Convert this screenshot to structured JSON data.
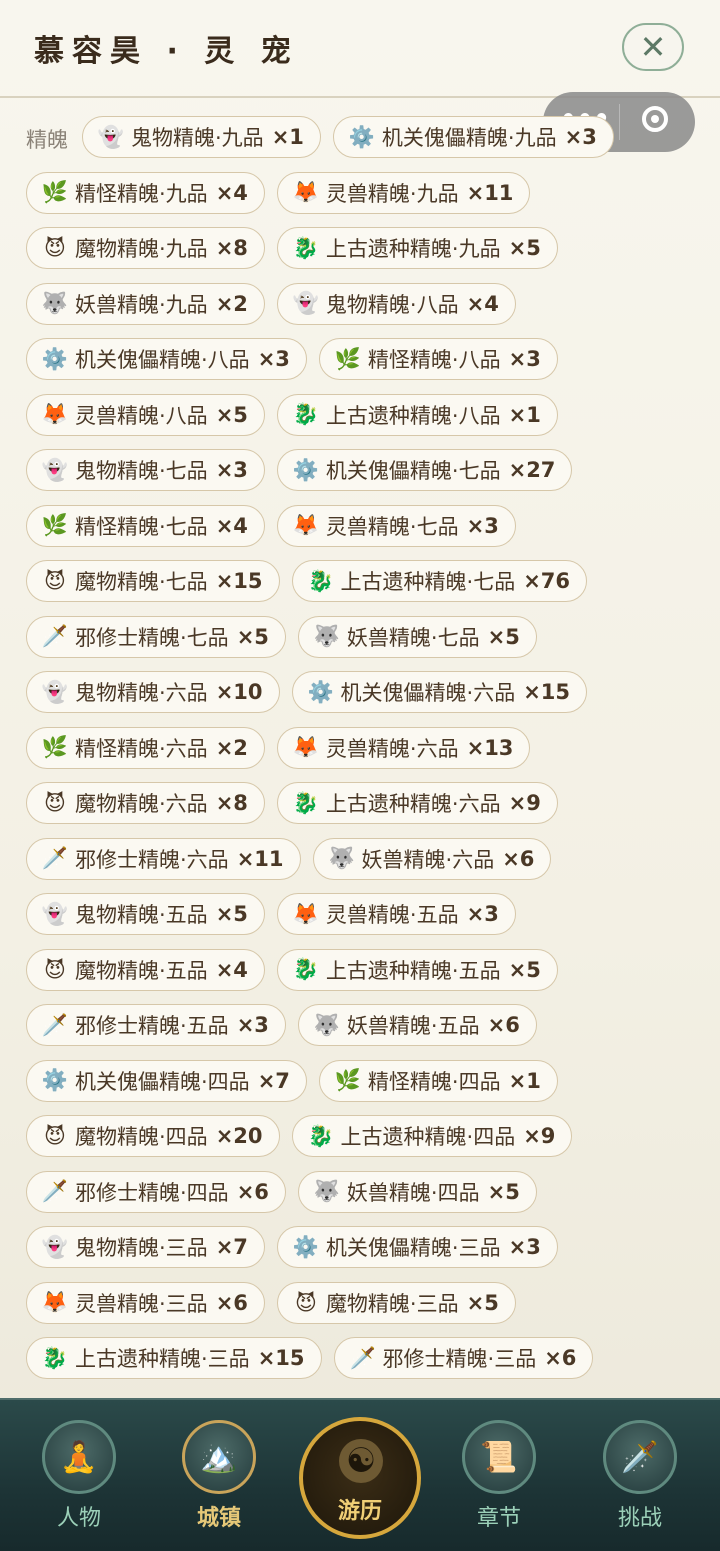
{
  "header": {
    "title": "慕容昊 · 灵 宠",
    "close_glyph": "✕"
  },
  "capsule": {
    "more_glyph": "•••"
  },
  "section": {
    "label": "精魄"
  },
  "rows": [
    [
      {
        "icon": "👻",
        "name": "鬼物精魄·九品",
        "count": "×1"
      },
      {
        "icon": "⚙️",
        "name": "机关傀儡精魄·九品",
        "count": "×3"
      }
    ],
    [
      {
        "icon": "🌿",
        "name": "精怪精魄·九品",
        "count": "×4"
      },
      {
        "icon": "🦊",
        "name": "灵兽精魄·九品",
        "count": "×11"
      }
    ],
    [
      {
        "icon": "😈",
        "name": "魔物精魄·九品",
        "count": "×8"
      },
      {
        "icon": "🐉",
        "name": "上古遗种精魄·九品",
        "count": "×5"
      }
    ],
    [
      {
        "icon": "🐺",
        "name": "妖兽精魄·九品",
        "count": "×2"
      },
      {
        "icon": "👻",
        "name": "鬼物精魄·八品",
        "count": "×4"
      }
    ],
    [
      {
        "icon": "⚙️",
        "name": "机关傀儡精魄·八品",
        "count": "×3"
      },
      {
        "icon": "🌿",
        "name": "精怪精魄·八品",
        "count": "×3"
      }
    ],
    [
      {
        "icon": "🦊",
        "name": "灵兽精魄·八品",
        "count": "×5"
      },
      {
        "icon": "🐉",
        "name": "上古遗种精魄·八品",
        "count": "×1"
      }
    ],
    [
      {
        "icon": "👻",
        "name": "鬼物精魄·七品",
        "count": "×3"
      },
      {
        "icon": "⚙️",
        "name": "机关傀儡精魄·七品",
        "count": "×27"
      }
    ],
    [
      {
        "icon": "🌿",
        "name": "精怪精魄·七品",
        "count": "×4"
      },
      {
        "icon": "🦊",
        "name": "灵兽精魄·七品",
        "count": "×3"
      }
    ],
    [
      {
        "icon": "😈",
        "name": "魔物精魄·七品",
        "count": "×15"
      },
      {
        "icon": "🐉",
        "name": "上古遗种精魄·七品",
        "count": "×76"
      }
    ],
    [
      {
        "icon": "🗡️",
        "name": "邪修士精魄·七品",
        "count": "×5"
      },
      {
        "icon": "🐺",
        "name": "妖兽精魄·七品",
        "count": "×5"
      }
    ],
    [
      {
        "icon": "👻",
        "name": "鬼物精魄·六品",
        "count": "×10"
      },
      {
        "icon": "⚙️",
        "name": "机关傀儡精魄·六品",
        "count": "×15"
      }
    ],
    [
      {
        "icon": "🌿",
        "name": "精怪精魄·六品",
        "count": "×2"
      },
      {
        "icon": "🦊",
        "name": "灵兽精魄·六品",
        "count": "×13"
      }
    ],
    [
      {
        "icon": "😈",
        "name": "魔物精魄·六品",
        "count": "×8"
      },
      {
        "icon": "🐉",
        "name": "上古遗种精魄·六品",
        "count": "×9"
      }
    ],
    [
      {
        "icon": "🗡️",
        "name": "邪修士精魄·六品",
        "count": "×11"
      },
      {
        "icon": "🐺",
        "name": "妖兽精魄·六品",
        "count": "×6"
      }
    ],
    [
      {
        "icon": "👻",
        "name": "鬼物精魄·五品",
        "count": "×5"
      },
      {
        "icon": "🦊",
        "name": "灵兽精魄·五品",
        "count": "×3"
      }
    ],
    [
      {
        "icon": "😈",
        "name": "魔物精魄·五品",
        "count": "×4"
      },
      {
        "icon": "🐉",
        "name": "上古遗种精魄·五品",
        "count": "×5"
      }
    ],
    [
      {
        "icon": "🗡️",
        "name": "邪修士精魄·五品",
        "count": "×3"
      },
      {
        "icon": "🐺",
        "name": "妖兽精魄·五品",
        "count": "×6"
      }
    ],
    [
      {
        "icon": "⚙️",
        "name": "机关傀儡精魄·四品",
        "count": "×7"
      },
      {
        "icon": "🌿",
        "name": "精怪精魄·四品",
        "count": "×1"
      }
    ],
    [
      {
        "icon": "😈",
        "name": "魔物精魄·四品",
        "count": "×20"
      },
      {
        "icon": "🐉",
        "name": "上古遗种精魄·四品",
        "count": "×9"
      }
    ],
    [
      {
        "icon": "🗡️",
        "name": "邪修士精魄·四品",
        "count": "×6"
      },
      {
        "icon": "🐺",
        "name": "妖兽精魄·四品",
        "count": "×5"
      }
    ],
    [
      {
        "icon": "👻",
        "name": "鬼物精魄·三品",
        "count": "×7"
      },
      {
        "icon": "⚙️",
        "name": "机关傀儡精魄·三品",
        "count": "×3"
      }
    ],
    [
      {
        "icon": "🦊",
        "name": "灵兽精魄·三品",
        "count": "×6"
      },
      {
        "icon": "😈",
        "name": "魔物精魄·三品",
        "count": "×5"
      }
    ],
    [
      {
        "icon": "🐉",
        "name": "上古遗种精魄·三品",
        "count": "×15"
      },
      {
        "icon": "🗡️",
        "name": "邪修士精魄·三品",
        "count": "×6"
      }
    ]
  ],
  "nav": {
    "items": [
      {
        "label": "人物",
        "icon": "🧘"
      },
      {
        "label": "城镇",
        "icon": "🏔️"
      },
      {
        "label": "游历",
        "icon": "☯"
      },
      {
        "label": "章节",
        "icon": "📜"
      },
      {
        "label": "挑战",
        "icon": "🗡️"
      }
    ]
  }
}
